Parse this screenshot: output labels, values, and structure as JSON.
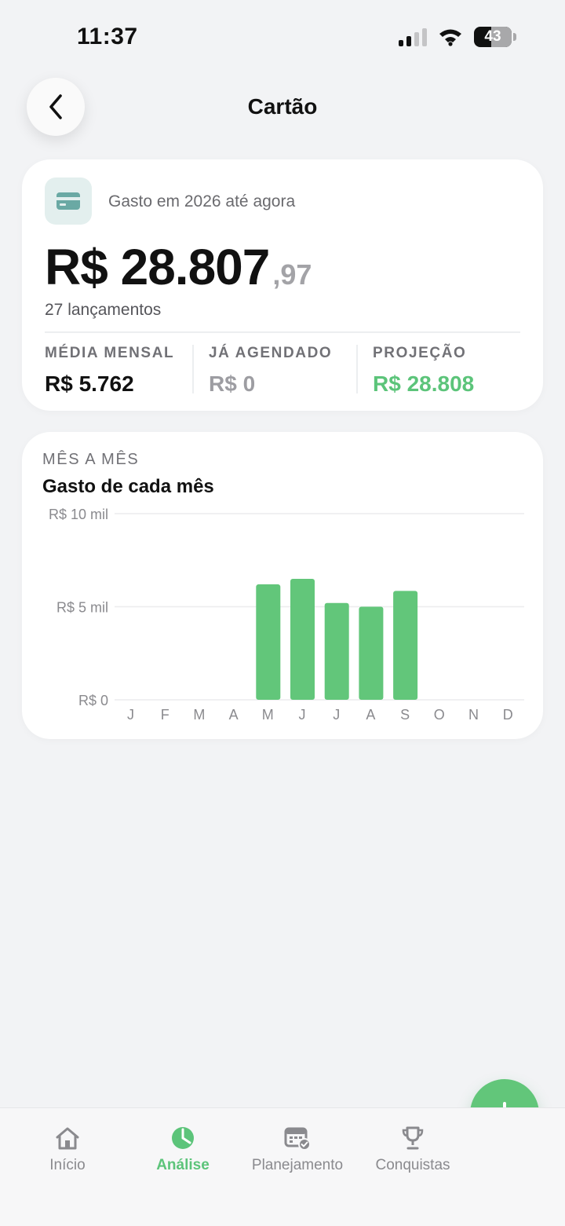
{
  "status_bar": {
    "time": "11:37",
    "battery": "43"
  },
  "header": {
    "title": "Cartão"
  },
  "summary": {
    "caption": "Gasto em 2026 até agora",
    "amount_main": "R$ 28.807",
    "amount_cents": ",97",
    "launches": "27 lançamentos",
    "stats": [
      {
        "label": "MÉDIA MENSAL",
        "value": "R$ 5.762"
      },
      {
        "label": "JÁ AGENDADO",
        "value": "R$ 0"
      },
      {
        "label": "PROJEÇÃO",
        "value": "R$ 28.808"
      }
    ]
  },
  "chart_section": {
    "eyebrow": "MÊS A MÊS",
    "title": "Gasto de cada mês"
  },
  "chart_data": {
    "type": "bar",
    "categories": [
      "J",
      "F",
      "M",
      "A",
      "M",
      "J",
      "J",
      "A",
      "S",
      "O",
      "N",
      "D"
    ],
    "values": [
      0,
      0,
      0,
      0,
      6200,
      6500,
      5200,
      5000,
      5850,
      0,
      0,
      0
    ],
    "ylim": [
      0,
      10000
    ],
    "y_ticks": [
      {
        "value": 10000,
        "label": "R$ 10 mil"
      },
      {
        "value": 5000,
        "label": "R$ 5 mil"
      },
      {
        "value": 0,
        "label": "R$ 0"
      }
    ],
    "grid": true,
    "bar_color": "#62c67a"
  },
  "tabs": [
    {
      "label": "Início",
      "icon": "home-icon",
      "active": false
    },
    {
      "label": "Análise",
      "icon": "pie-chart-icon",
      "active": true
    },
    {
      "label": "Planejamento",
      "icon": "calendar-check-icon",
      "active": false
    },
    {
      "label": "Conquistas",
      "icon": "trophy-icon",
      "active": false
    }
  ],
  "colors": {
    "accent": "#62c67a",
    "background": "#f2f3f5",
    "card": "#ffffff"
  }
}
